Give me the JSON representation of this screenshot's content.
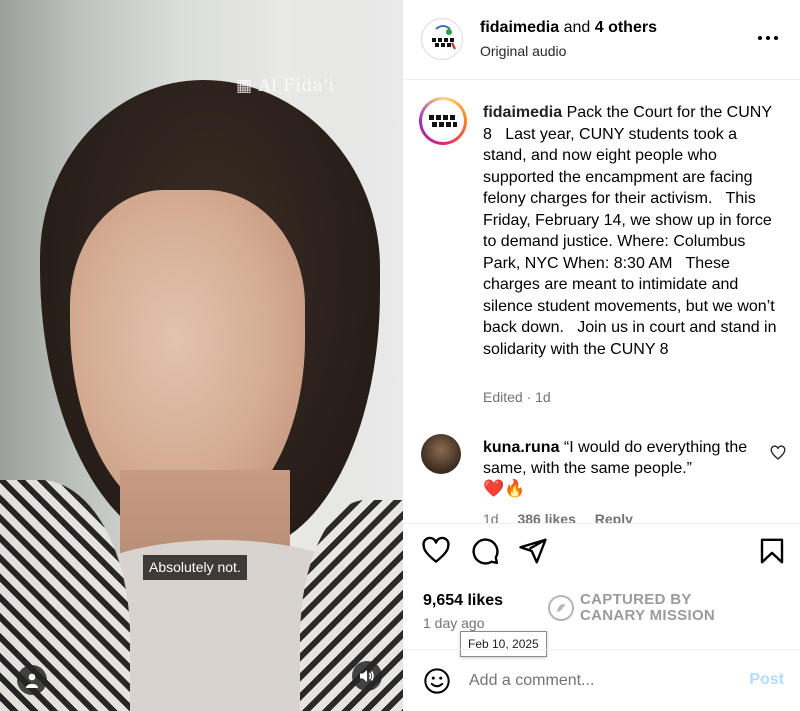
{
  "video": {
    "watermark": "Al Fida'i",
    "subtitle": "Absolutely not."
  },
  "header": {
    "username": "fidaimedia",
    "and_others": " and ",
    "others_bold": "4 others",
    "audio": "Original audio"
  },
  "caption": {
    "username": "fidaimedia",
    "text": " Pack the Court for the CUNY 8   Last year, CUNY students took a stand, and now eight people who supported the encampment are facing felony charges for their activism.   This Friday, February 14, we show up in force to demand justice. Where: Columbus Park, NYC When: 8:30 AM   These charges are meant to intimidate and silence student movements, but we won’t back down.   Join us in court and stand in solidarity with the CUNY 8",
    "meta": "Edited · 1d"
  },
  "comment": {
    "username": "kuna.runa",
    "text": " “I would do everything the same, with the same people.”",
    "emoji": "❤️🔥",
    "age": "1d",
    "likes": "386 likes",
    "reply": "Reply"
  },
  "stats": {
    "likes": "9,654 likes",
    "time": "1 day ago",
    "tooltip": "Feb 10, 2025"
  },
  "stamp": {
    "line1": "CAPTURED BY",
    "line2": "CANARY MISSION"
  },
  "add_comment": {
    "placeholder": "Add a comment...",
    "post_label": "Post"
  },
  "colors": {
    "post_disabled": "#b3dbff",
    "muted": "#737373",
    "story_ring": [
      "#feda75",
      "#fa7e1e",
      "#d62976",
      "#962fbf"
    ]
  }
}
